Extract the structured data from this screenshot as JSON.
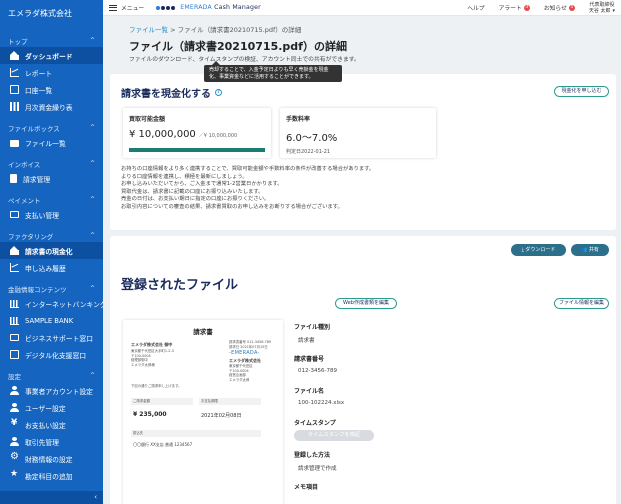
{
  "sidebar": {
    "company": "エメラダ株式会社",
    "sections": [
      {
        "label": "トップ",
        "items": [
          {
            "label": "ダッシュボード",
            "icon": "home-icon",
            "active": true
          },
          {
            "label": "レポート",
            "icon": "chart-icon"
          },
          {
            "label": "口座一覧",
            "icon": "bank-account-icon"
          },
          {
            "label": "月次資金繰り表",
            "icon": "table-icon"
          }
        ]
      },
      {
        "label": "ファイルボックス",
        "items": [
          {
            "label": "ファイル一覧",
            "icon": "folder-icon"
          }
        ]
      },
      {
        "label": "インボイス",
        "items": [
          {
            "label": "請求管理",
            "icon": "document-icon"
          }
        ]
      },
      {
        "label": "ペイメント",
        "items": [
          {
            "label": "支払い管理",
            "icon": "card-icon"
          }
        ]
      },
      {
        "label": "ファクタリング",
        "items": [
          {
            "label": "請求書の現金化",
            "icon": "home-icon",
            "active": true
          },
          {
            "label": "申し込み履歴",
            "icon": "chart-icon"
          }
        ]
      },
      {
        "label": "金融情報コンテンツ",
        "items": [
          {
            "label": "インターネットバンキング",
            "icon": "bank-icon"
          },
          {
            "label": "SAMPLE BANK",
            "icon": "bank-icon"
          },
          {
            "label": "ビジネスサポート窓口",
            "icon": "support-icon"
          },
          {
            "label": "デジタル化支援窓口",
            "icon": "digital-icon"
          }
        ]
      },
      {
        "label": "設定",
        "items": [
          {
            "label": "事業者アカウント設定",
            "icon": "user-icon"
          },
          {
            "label": "ユーザー設定",
            "icon": "user-icon"
          },
          {
            "label": "お支払い設定",
            "icon": "yen-icon"
          },
          {
            "label": "取引先管理",
            "icon": "user-icon"
          },
          {
            "label": "財務情報の設定",
            "icon": "gear-icon"
          },
          {
            "label": "勘定科目の追加",
            "icon": "star-icon"
          }
        ]
      }
    ],
    "collapse_glyph": "‹"
  },
  "header": {
    "menu_label": "メニュー",
    "logo_primary": "EMERADA",
    "logo_secondary": "Cash Manager",
    "help": "ヘルプ",
    "alert": "アラート",
    "alert_count": "3",
    "notice": "お知らせ",
    "notice_count": "5",
    "user_line1": "代表取締役",
    "user_line2": "天谷 太郎",
    "caret": "▾"
  },
  "breadcrumb": {
    "root": "ファイル一覧",
    "sep": ">",
    "current": "ファイル（請求書20210715.pdf）の詳細"
  },
  "page": {
    "title": "ファイル（請求書20210715.pdf）の詳細",
    "subtitle": "ファイルのダウンロード、タイムスタンプの検証、アカウント同士での共有ができます。"
  },
  "tooltip": {
    "line1": "売却することで、入金予定日よりも早く売掛金を現金",
    "line2": "化、事業資金などに活用することができます。"
  },
  "cashout": {
    "title": "請求書を現金化する",
    "help_glyph": "?",
    "apply_button": "現金化を申し込む",
    "card1": {
      "label": "買取可能金額",
      "value": "¥ 10,000,000",
      "sub": "／¥ 10,000,000",
      "progress": 1.0
    },
    "card2": {
      "label": "手数料率",
      "value": "6.0〜7.0%",
      "date": "判定日2022-01-21"
    },
    "notes": [
      "お持ちの口座情報をより多く連携することで、買取可能金額や手数料率の条件が改善する場合があります。",
      "よりる口座情報を連携し、積極を最新にしましょう。",
      "お申し込みいただいてから、ご入金まで通常1-2営業日かかります。",
      "買取代金は、請求書に記載の口座にお振り込みいたします。",
      "売金の日付は、お支払い期日に指定の口座にお振りください。",
      "お取引内容についての審査の結果、請求書買取のお申し込みをお断りする場合がございます。"
    ]
  },
  "files": {
    "download_button": "ダウンロード",
    "share_button": "共有",
    "title": "登録されたファイル",
    "web_button": "Web作成書類を編集",
    "edit_button": "ファイル情報を編集"
  },
  "invoice_preview": {
    "title": "請求書",
    "to_company": "エメラダ株式会社 御中",
    "to_lines": [
      "東京都千代田区大手町1-2-3",
      "〒100-0004",
      "経理部御中",
      "エメラダ太郎様"
    ],
    "from_lines": [
      "請求書番号 012-3456-789",
      "請求日 2021年07月15日"
    ],
    "brand": "-EMERADA-",
    "from_company": "エメラダ株式会社",
    "from_detail": [
      "東京都千代田区",
      "〒100-0004",
      "経営企画部",
      "エメラダ太郎"
    ],
    "greeting": "下記の通りご請求申し上げます。",
    "amount_label": "ご請求金額",
    "amount": "¥ 235,000",
    "due_label": "お支払期限",
    "due": "2021年02月08日",
    "bank_label": "振込先",
    "bank": "〇〇銀行 XX支店 普通 1234567"
  },
  "meta": {
    "type_label": "ファイル種別",
    "type_value": "請求書",
    "number_label": "請求書番号",
    "number_value": "012-3456-789",
    "filename_label": "ファイル名",
    "filename_value": "100-102224.xlsx",
    "timestamp_label": "タイムスタンプ",
    "timestamp_button": "タイムスタンプを検証",
    "method_label": "登録した方法",
    "method_value": "請求管理で作成",
    "memo_label": "メモ項目"
  }
}
